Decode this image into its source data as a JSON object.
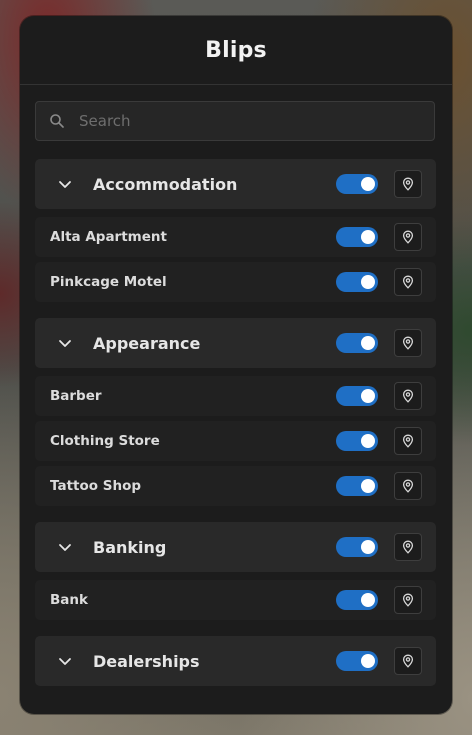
{
  "panel": {
    "title": "Blips",
    "search_placeholder": "Search"
  },
  "colors": {
    "toggle_on": "#1f6fc5",
    "panel_bg": "#1c1c1c",
    "category_bg": "#292929",
    "item_bg": "#212121"
  },
  "categories": [
    {
      "label": "Accommodation",
      "enabled": true,
      "items": [
        {
          "label": "Alta Apartment",
          "enabled": true
        },
        {
          "label": "Pinkcage Motel",
          "enabled": true
        }
      ]
    },
    {
      "label": "Appearance",
      "enabled": true,
      "items": [
        {
          "label": "Barber",
          "enabled": true
        },
        {
          "label": "Clothing Store",
          "enabled": true
        },
        {
          "label": "Tattoo Shop",
          "enabled": true
        }
      ]
    },
    {
      "label": "Banking",
      "enabled": true,
      "items": [
        {
          "label": "Bank",
          "enabled": true
        }
      ]
    },
    {
      "label": "Dealerships",
      "enabled": true,
      "items": []
    }
  ]
}
